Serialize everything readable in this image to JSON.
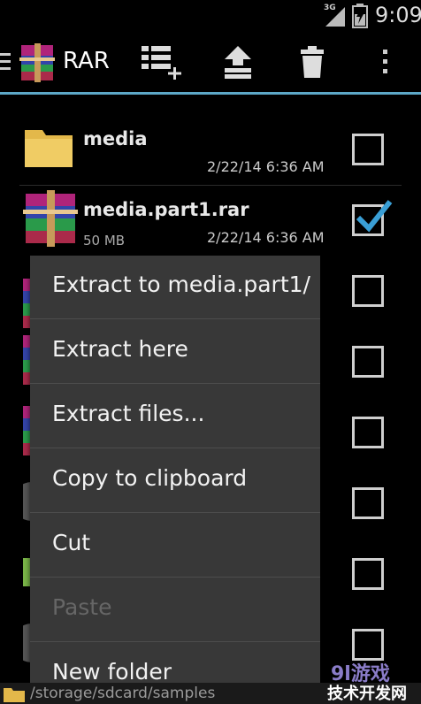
{
  "status_bar": {
    "network": "3G",
    "time": "9:09"
  },
  "action_bar": {
    "title": "RAR",
    "icons": [
      "menu-icon",
      "rar-logo-icon",
      "select-all-icon",
      "upload-icon",
      "trash-icon",
      "overflow-icon"
    ]
  },
  "files": [
    {
      "name": "media",
      "size": "",
      "date": "2/22/14 6:36 AM",
      "type": "folder",
      "checked": false
    },
    {
      "name": "media.part1.rar",
      "size": "50 MB",
      "date": "2/22/14 6:36 AM",
      "type": "rar",
      "checked": true
    },
    {
      "name": "",
      "size": "",
      "date": "",
      "type": "rar",
      "checked": false
    },
    {
      "name": "",
      "size": "",
      "date": "",
      "type": "rar",
      "checked": false
    },
    {
      "name": "",
      "size": "",
      "date": "",
      "type": "rar",
      "checked": false
    },
    {
      "name": "",
      "size": "",
      "date": "",
      "type": "disc",
      "checked": false
    },
    {
      "name": "",
      "size": "",
      "date": "",
      "type": "apk",
      "checked": false
    },
    {
      "name": "",
      "size": "",
      "date": "",
      "type": "disc",
      "checked": false
    }
  ],
  "context_menu": {
    "items": [
      {
        "label": "Extract to media.part1/",
        "enabled": true
      },
      {
        "label": "Extract here",
        "enabled": true
      },
      {
        "label": "Extract files...",
        "enabled": true
      },
      {
        "label": "Copy to clipboard",
        "enabled": true
      },
      {
        "label": "Cut",
        "enabled": true
      },
      {
        "label": "Paste",
        "enabled": false
      },
      {
        "label": "New folder",
        "enabled": true
      }
    ]
  },
  "path_bar": {
    "path": "/storage/sdcard/samples"
  },
  "watermark": {
    "line1": "9l游戏",
    "line2": "技术开发网"
  },
  "colors": {
    "accent": "#5da8c8",
    "checkmark": "#3a9fd6",
    "menu_bg": "#383838"
  }
}
